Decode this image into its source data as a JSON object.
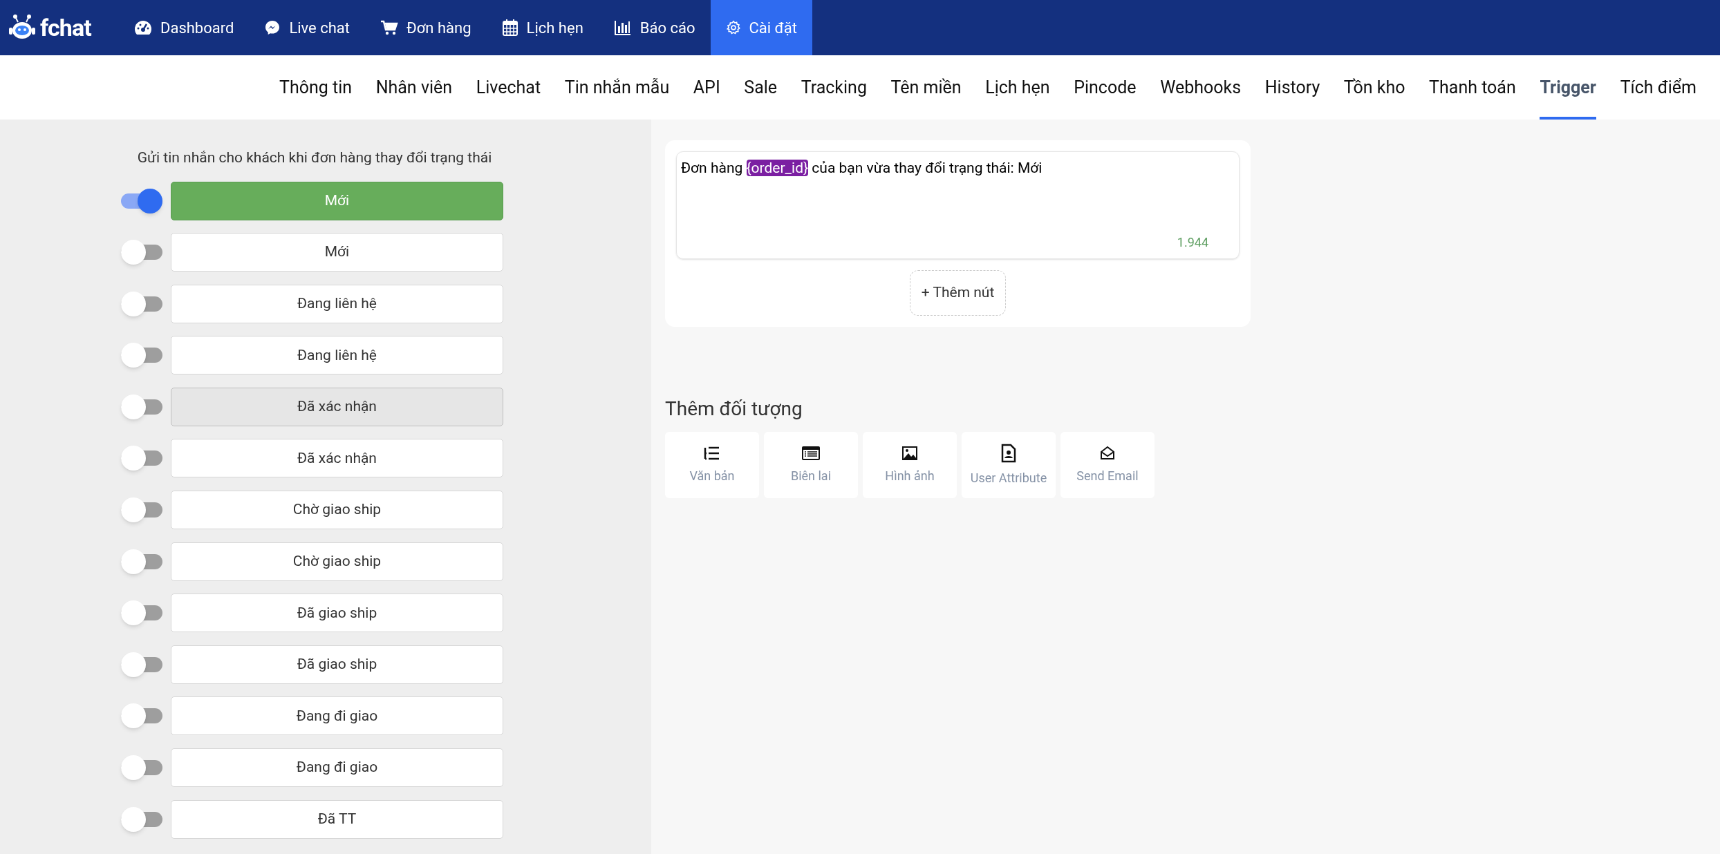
{
  "topbar": {
    "logo": "fchat",
    "items": [
      {
        "label": "Dashboard",
        "kind": "gauge",
        "selected": false
      },
      {
        "label": "Live chat",
        "kind": "messenger",
        "selected": false
      },
      {
        "label": "Đơn hàng",
        "kind": "cart",
        "selected": false
      },
      {
        "label": "Lịch hẹn",
        "kind": "calendar",
        "selected": false
      },
      {
        "label": "Báo cáo",
        "kind": "chart",
        "selected": false
      },
      {
        "label": "Cài đặt",
        "kind": "gear",
        "selected": true
      }
    ]
  },
  "tabs": [
    {
      "label": "Thông tin",
      "selected": false
    },
    {
      "label": "Nhân viên",
      "selected": false
    },
    {
      "label": "Livechat",
      "selected": false
    },
    {
      "label": "Tin nhắn mẫu",
      "selected": false
    },
    {
      "label": "API",
      "selected": false
    },
    {
      "label": "Sale",
      "selected": false
    },
    {
      "label": "Tracking",
      "selected": false
    },
    {
      "label": "Tên miền",
      "selected": false
    },
    {
      "label": "Lịch hẹn",
      "selected": false
    },
    {
      "label": "Pincode",
      "selected": false
    },
    {
      "label": "Webhooks",
      "selected": false
    },
    {
      "label": "History",
      "selected": false
    },
    {
      "label": "Tồn kho",
      "selected": false
    },
    {
      "label": "Thanh toán",
      "selected": false
    },
    {
      "label": "Trigger",
      "selected": true
    },
    {
      "label": "Tích điểm",
      "selected": false
    }
  ],
  "statuses": {
    "heading": "Gửi tin nhắn cho khách khi đơn hàng thay đổi trạng thái",
    "items": [
      {
        "label": "Mới",
        "on": true,
        "selected": true,
        "highlighted": false
      },
      {
        "label": "Mới",
        "on": false,
        "selected": false,
        "highlighted": false
      },
      {
        "label": "Đang liên hệ",
        "on": false,
        "selected": false,
        "highlighted": false
      },
      {
        "label": "Đang liên hệ",
        "on": false,
        "selected": false,
        "highlighted": false
      },
      {
        "label": "Đã xác nhận",
        "on": false,
        "selected": false,
        "highlighted": true
      },
      {
        "label": "Đã xác nhận",
        "on": false,
        "selected": false,
        "highlighted": false
      },
      {
        "label": "Chờ giao ship",
        "on": false,
        "selected": false,
        "highlighted": false
      },
      {
        "label": "Chờ giao ship",
        "on": false,
        "selected": false,
        "highlighted": false
      },
      {
        "label": "Đã giao ship",
        "on": false,
        "selected": false,
        "highlighted": false
      },
      {
        "label": "Đã giao ship",
        "on": false,
        "selected": false,
        "highlighted": false
      },
      {
        "label": "Đang đi giao",
        "on": false,
        "selected": false,
        "highlighted": false
      },
      {
        "label": "Đang đi giao",
        "on": false,
        "selected": false,
        "highlighted": false
      },
      {
        "label": "Đã TT",
        "on": false,
        "selected": false,
        "highlighted": false
      }
    ]
  },
  "message": {
    "parts": [
      {
        "text": "Đơn hàng ",
        "kind": "plain"
      },
      {
        "text": "{order_id}",
        "kind": "variable"
      },
      {
        "text": " của bạn vừa thay đổi trạng thái: Mới",
        "kind": "plain"
      }
    ],
    "counter": "1.944",
    "add_button": "+ Thêm nút"
  },
  "objects": {
    "title": "Thêm đối tượng",
    "items": [
      {
        "label": "Văn bản",
        "kind": "text"
      },
      {
        "label": "Biên lai",
        "kind": "receipt"
      },
      {
        "label": "Hình ảnh",
        "kind": "image"
      },
      {
        "label": "User Attribute",
        "kind": "user-doc"
      },
      {
        "label": "Send Email",
        "kind": "envelope"
      }
    ]
  }
}
